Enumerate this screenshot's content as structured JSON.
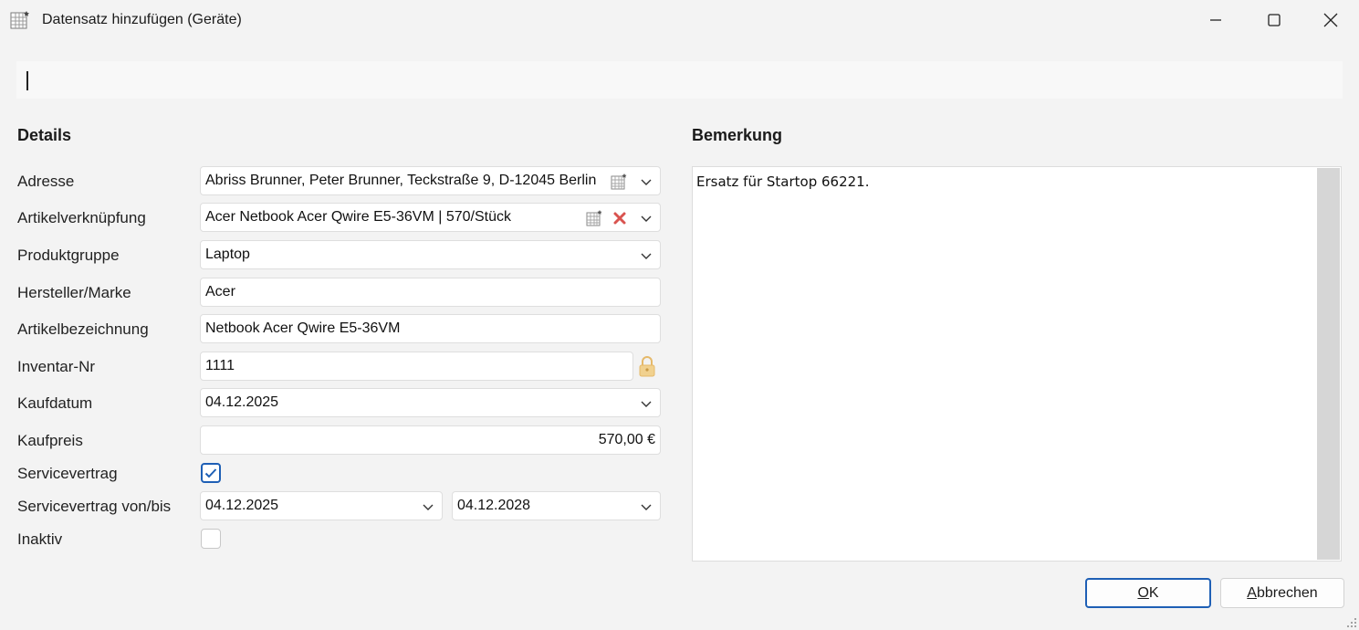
{
  "window": {
    "title": "Datensatz hinzufügen (Geräte)",
    "icons": {
      "app": "table-new-icon",
      "minimize": "minimize-icon",
      "maximize": "maximize-icon",
      "close": "close-icon"
    }
  },
  "details": {
    "heading": "Details",
    "labels": {
      "adresse": "Adresse",
      "artikel": "Artikelverknüpfung",
      "produktgruppe": "Produktgruppe",
      "hersteller": "Hersteller/Marke",
      "artikelbez": "Artikelbezeichnung",
      "inventar": "Inventar-Nr",
      "kaufdatum": "Kaufdatum",
      "kaufpreis": "Kaufpreis",
      "servicevertrag": "Servicevertrag",
      "service_von_bis": "Servicevertrag von/bis",
      "inaktiv": "Inaktiv"
    },
    "values": {
      "adresse": "Abriss Brunner, Peter Brunner, Teckstraße 9, D-12045 Berlin",
      "artikel": "Acer Netbook Acer Qwire E5-36VM | 570/Stück",
      "produktgruppe": "Laptop",
      "hersteller": "Acer",
      "artikelbez": "Netbook Acer Qwire E5-36VM",
      "inventar": "1111",
      "kaufdatum": "04.12.2025",
      "kaufpreis": "570,00 €",
      "servicevertrag_checked": true,
      "service_von": "04.12.2025",
      "service_bis": "04.12.2028",
      "inaktiv_checked": false
    }
  },
  "bemerkung": {
    "heading": "Bemerkung",
    "text": "Ersatz für Startop 66221."
  },
  "buttons": {
    "ok_u": "O",
    "ok_rest": "K",
    "cancel_u": "A",
    "cancel_rest": "bbrechen"
  },
  "colors": {
    "accent": "#1e5fb5",
    "delete": "#d9534f",
    "lock": "#e5b96a"
  }
}
